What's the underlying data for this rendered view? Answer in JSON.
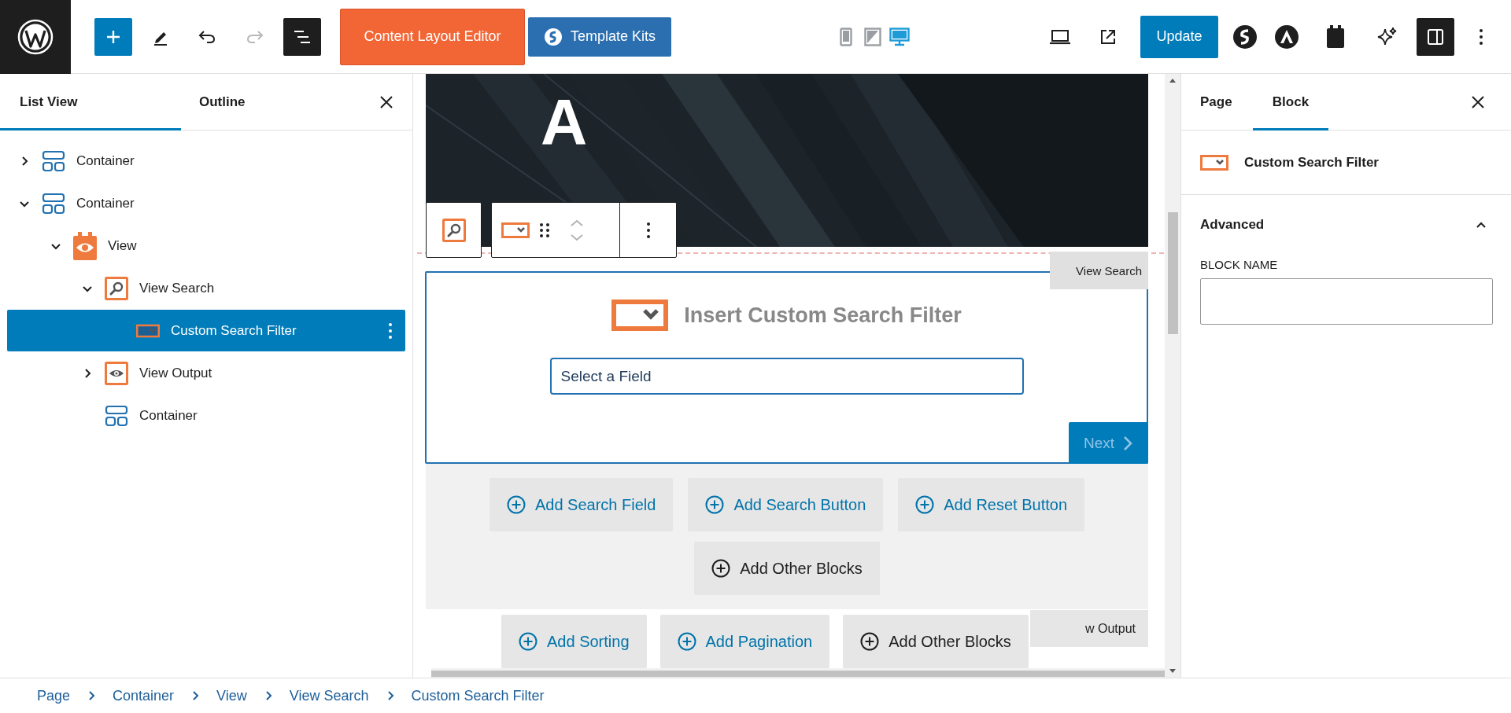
{
  "top_bar": {
    "content_layout_editor": "Content Layout Editor",
    "template_kits": "Template Kits",
    "devices": [
      {
        "kind": "mobile",
        "selected": false
      },
      {
        "kind": "tablet",
        "selected": false
      },
      {
        "kind": "desktop",
        "selected": true
      }
    ],
    "update": "Update"
  },
  "list_panel": {
    "tabs": [
      {
        "label": "List View",
        "selected": true
      },
      {
        "label": "Outline",
        "selected": false
      }
    ],
    "tree": [
      {
        "label": "Container",
        "kind": "container",
        "selected": false,
        "expanded": false
      },
      {
        "label": "Container",
        "kind": "container",
        "selected": false,
        "expanded": true,
        "children": [
          {
            "label": "View",
            "kind": "view",
            "selected": false,
            "expanded": true,
            "children": [
              {
                "label": "View Search",
                "kind": "view-search",
                "selected": false,
                "expanded": true,
                "children": [
                  {
                    "label": "Custom Search Filter",
                    "kind": "filter",
                    "selected": true
                  }
                ]
              },
              {
                "label": "View Output",
                "kind": "view-output",
                "selected": false,
                "expanded": false
              },
              {
                "label": "Container",
                "kind": "container",
                "selected": false
              }
            ]
          }
        ]
      }
    ]
  },
  "canvas": {
    "hero_heading": "A",
    "search_label": "View Search",
    "filter_title": "Insert Custom Search Filter",
    "field_value": "Select a Field",
    "next": {
      "label": "Next",
      "disabled": true
    },
    "search_actions": [
      {
        "label": "Add Search Field",
        "kind": "add"
      },
      {
        "label": "Add Search Button",
        "kind": "add"
      },
      {
        "label": "Add Reset Button",
        "kind": "add"
      },
      {
        "label": "Add Other Blocks",
        "kind": "other"
      }
    ],
    "output_label": "w Output",
    "output_actions": [
      {
        "label": "Add Sorting",
        "kind": "add"
      },
      {
        "label": "Add Pagination",
        "kind": "add"
      },
      {
        "label": "Add Other Blocks",
        "kind": "other"
      }
    ]
  },
  "settings": {
    "tabs": [
      {
        "label": "Page",
        "selected": false
      },
      {
        "label": "Block",
        "selected": true
      }
    ],
    "block_title": "Custom Search Filter",
    "section": {
      "title": "Advanced",
      "expanded": true
    },
    "field_label": "BLOCK NAME"
  },
  "breadcrumb": [
    "Page",
    "Container",
    "View",
    "View Search",
    "Custom Search Filter"
  ]
}
